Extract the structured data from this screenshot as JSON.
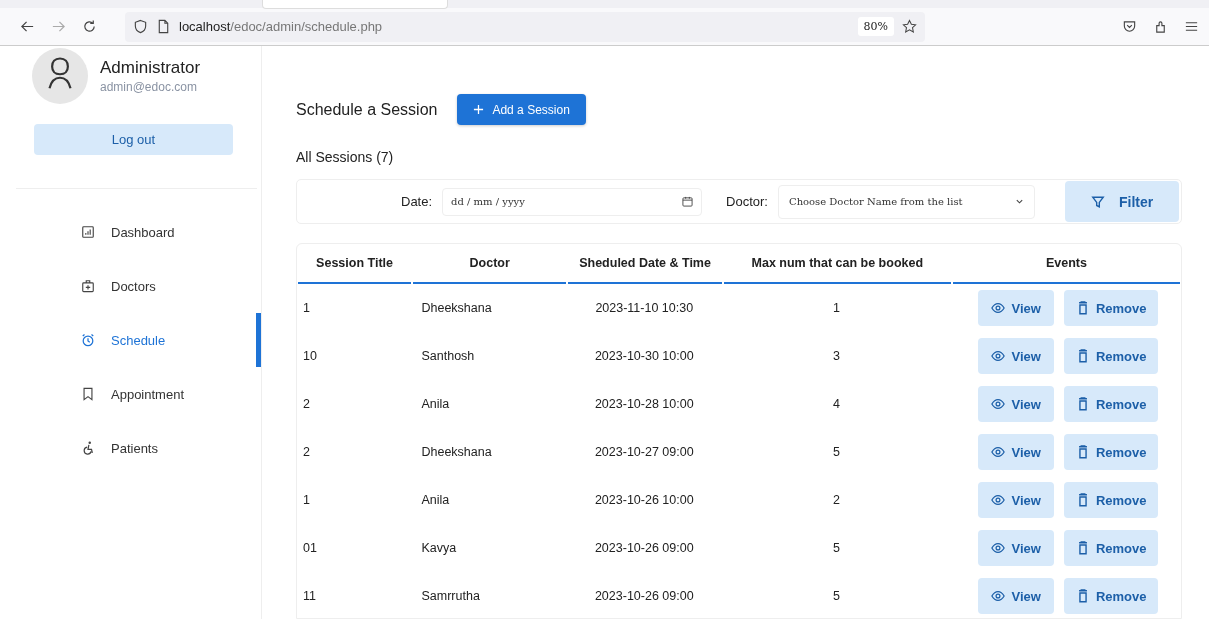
{
  "browser": {
    "url_host": "localhost",
    "url_path": "/edoc/admin/schedule.php",
    "zoom": "80%"
  },
  "sidebar": {
    "profile": {
      "name": "Administrator",
      "email": "admin@edoc.com"
    },
    "logout": "Log out",
    "items": [
      {
        "label": "Dashboard",
        "kind": "dashboard",
        "selected": false
      },
      {
        "label": "Doctors",
        "kind": "doctors",
        "selected": false
      },
      {
        "label": "Schedule",
        "kind": "schedule",
        "selected": true
      },
      {
        "label": "Appointment",
        "kind": "appointment",
        "selected": false
      },
      {
        "label": "Patients",
        "kind": "patients",
        "selected": false
      }
    ]
  },
  "header": {
    "title": "Schedule a Session",
    "add_button": "Add a Session"
  },
  "sessions_heading": "All Sessions (7)",
  "filter": {
    "date_label": "Date:",
    "date_placeholder": "dd / mm / yyyy",
    "doctor_label": "Doctor:",
    "doctor_value": "Choose Doctor Name from the list",
    "button": "Filter"
  },
  "table": {
    "columns": [
      "Session Title",
      "Doctor",
      "Sheduled Date & Time",
      "Max num that can be booked",
      "Events"
    ],
    "rows": [
      {
        "cells": [
          "1",
          "Dheekshana",
          "2023-11-10 10:30",
          "1"
        ],
        "actions": [
          "View",
          "Remove"
        ]
      },
      {
        "cells": [
          "10",
          "Santhosh",
          "2023-10-30 10:00",
          "3"
        ],
        "actions": [
          "View",
          "Remove"
        ]
      },
      {
        "cells": [
          "2",
          "Anila",
          "2023-10-28 10:00",
          "4"
        ],
        "actions": [
          "View",
          "Remove"
        ]
      },
      {
        "cells": [
          "2",
          "Dheekshana",
          "2023-10-27 09:00",
          "5"
        ],
        "actions": [
          "View",
          "Remove"
        ]
      },
      {
        "cells": [
          "1",
          "Anila",
          "2023-10-26 10:00",
          "2"
        ],
        "actions": [
          "View",
          "Remove"
        ]
      },
      {
        "cells": [
          "01",
          "Kavya",
          "2023-10-26 09:00",
          "5"
        ],
        "actions": [
          "View",
          "Remove"
        ]
      },
      {
        "cells": [
          "11",
          "Samrrutha",
          "2023-10-26 09:00",
          "5"
        ],
        "actions": [
          "View",
          "Remove"
        ]
      }
    ]
  }
}
